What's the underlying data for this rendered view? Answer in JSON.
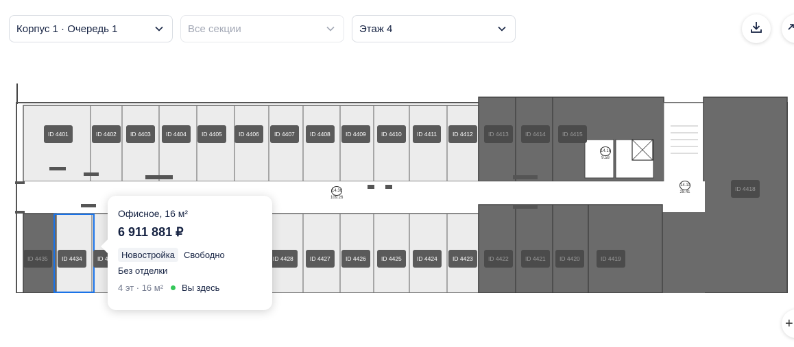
{
  "filters": {
    "building": {
      "value": "Корпус 1 · Очередь 1"
    },
    "section": {
      "placeholder": "Все секции"
    },
    "floor": {
      "value": "Этаж 4"
    }
  },
  "toolbar": {
    "download_icon": "download-icon",
    "expand_icon": "expand-icon",
    "zoom_icon": "plus-icon"
  },
  "plan": {
    "top_units": [
      {
        "label": "ID 4401",
        "status": "available"
      },
      {
        "label": "ID 4402",
        "status": "available"
      },
      {
        "label": "ID 4403",
        "status": "available"
      },
      {
        "label": "ID 4404",
        "status": "available"
      },
      {
        "label": "ID 4405",
        "status": "available"
      },
      {
        "label": "ID 4406",
        "status": "available"
      },
      {
        "label": "ID 4407",
        "status": "available"
      },
      {
        "label": "ID 4408",
        "status": "available"
      },
      {
        "label": "ID 4409",
        "status": "available"
      },
      {
        "label": "ID 4410",
        "status": "available"
      },
      {
        "label": "ID 4411",
        "status": "available"
      },
      {
        "label": "ID 4412",
        "status": "available"
      },
      {
        "label": "ID 4413",
        "status": "sold"
      },
      {
        "label": "ID 4414",
        "status": "sold"
      },
      {
        "label": "ID 4415",
        "status": "sold"
      }
    ],
    "bottom_units": [
      {
        "label": "ID 4435",
        "status": "sold"
      },
      {
        "label": "ID 4434",
        "status": "selected"
      },
      {
        "label": "ID 4",
        "status": "available"
      },
      {
        "label": "ID 4428",
        "status": "available"
      },
      {
        "label": "ID 4427",
        "status": "available"
      },
      {
        "label": "ID 4426",
        "status": "available"
      },
      {
        "label": "ID 4425",
        "status": "available"
      },
      {
        "label": "ID 4424",
        "status": "available"
      },
      {
        "label": "ID 4423",
        "status": "available"
      },
      {
        "label": "ID 4422",
        "status": "sold"
      },
      {
        "label": "ID 4421",
        "status": "sold"
      },
      {
        "label": "ID 4420",
        "status": "sold"
      },
      {
        "label": "ID 4419",
        "status": "sold"
      }
    ],
    "corner_unit": {
      "label": "ID 4418",
      "status": "sold"
    },
    "room_marks": [
      {
        "top": "14.36",
        "bottom": "109.26"
      },
      {
        "top": "14.16",
        "bottom": "9.58"
      },
      {
        "top": "14.11",
        "bottom": "28.41"
      }
    ]
  },
  "tooltip": {
    "title": "Офисное, 16 м²",
    "price": "6 911 881 ₽",
    "tags": [
      "Новостройка",
      "Свободно"
    ],
    "finish": "Без отделки",
    "meta": "4 эт · 16 м²",
    "status": "Вы здесь",
    "status_color": "#34c759"
  },
  "colors": {
    "sold": "#6b6b6b",
    "selected_border": "#1a73e8",
    "room_fill": "#ececec"
  }
}
